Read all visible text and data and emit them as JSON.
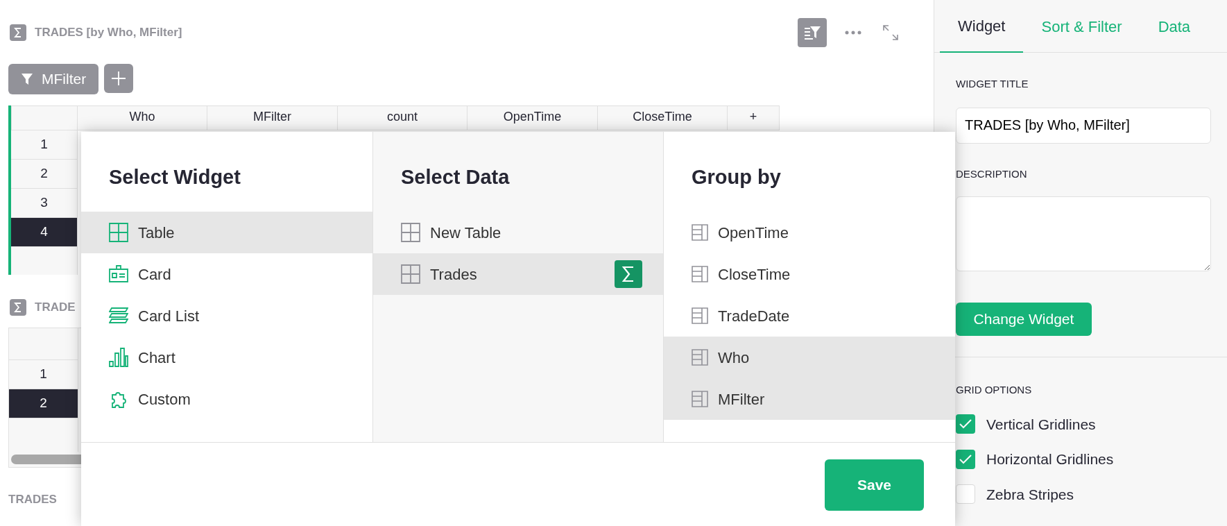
{
  "widget_header": {
    "title": "TRADES [by Who, MFilter]"
  },
  "filter_bar": {
    "filters": [
      "MFilter"
    ]
  },
  "grid": {
    "columns": [
      "Who",
      "MFilter",
      "count",
      "OpenTime",
      "CloseTime",
      "+"
    ],
    "rows": [
      {
        "label": "1",
        "selected": false
      },
      {
        "label": "2",
        "selected": false
      },
      {
        "label": "3",
        "selected": false
      },
      {
        "label": "4",
        "selected": true
      }
    ]
  },
  "second_widget": {
    "title": "TRADE",
    "rows": [
      {
        "label": "1",
        "selected": false
      },
      {
        "label": "2",
        "selected": true
      }
    ]
  },
  "third_widget": {
    "title": "TRADES"
  },
  "modal": {
    "widget_column": {
      "heading": "Select Widget",
      "items": [
        {
          "label": "Table",
          "kind": "table",
          "selected": true
        },
        {
          "label": "Card",
          "kind": "card",
          "selected": false
        },
        {
          "label": "Card List",
          "kind": "cardlist",
          "selected": false
        },
        {
          "label": "Chart",
          "kind": "chart",
          "selected": false
        },
        {
          "label": "Custom",
          "kind": "custom",
          "selected": false
        }
      ]
    },
    "data_column": {
      "heading": "Select Data",
      "items": [
        {
          "label": "New Table",
          "selected": false,
          "summary": false
        },
        {
          "label": "Trades",
          "selected": true,
          "summary": true
        }
      ]
    },
    "group_column": {
      "heading": "Group by",
      "items": [
        {
          "label": "OpenTime",
          "selected": false
        },
        {
          "label": "CloseTime",
          "selected": false
        },
        {
          "label": "TradeDate",
          "selected": false
        },
        {
          "label": "Who",
          "selected": true
        },
        {
          "label": "MFilter",
          "selected": true
        }
      ]
    },
    "save": "Save"
  },
  "sidebar": {
    "tabs": [
      {
        "label": "Widget",
        "selected": true
      },
      {
        "label": "Sort & Filter",
        "selected": false
      },
      {
        "label": "Data",
        "selected": false
      }
    ],
    "title_label": "WIDGET TITLE",
    "title_value": "TRADES [by Who, MFilter]",
    "description_label": "DESCRIPTION",
    "change_button": "Change Widget",
    "grid_options_label": "GRID OPTIONS",
    "options": [
      {
        "label": "Vertical Gridlines",
        "checked": true
      },
      {
        "label": "Horizontal Gridlines",
        "checked": true
      },
      {
        "label": "Zebra Stripes",
        "checked": false
      }
    ]
  }
}
